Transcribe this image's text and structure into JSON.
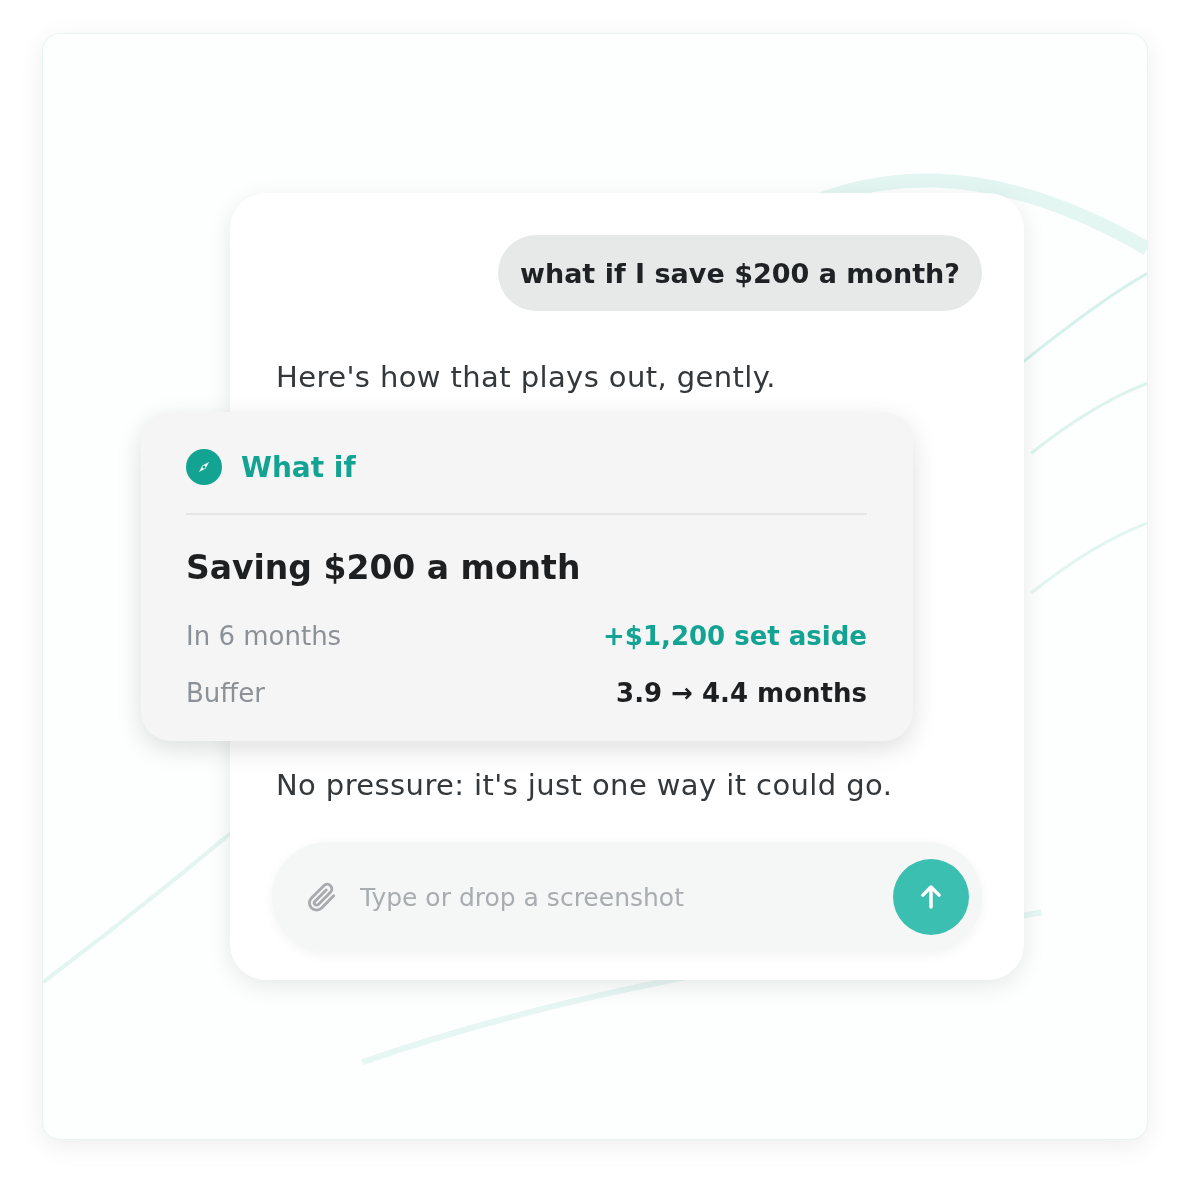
{
  "user_message": {
    "text": "what if I save $200 a month?"
  },
  "assistant": {
    "intro": "Here's how that plays out, gently.",
    "outro": "No pressure: it's just one way it could go."
  },
  "what_if_card": {
    "label": "What if",
    "title": "Saving $200 a month",
    "rows": [
      {
        "label": "In 6 months",
        "value": "+$1,200 set aside",
        "kind": "accent"
      },
      {
        "label": "Buffer",
        "value": "3.9 → 4.4 months",
        "kind": "strong"
      }
    ]
  },
  "composer": {
    "placeholder": "Type or drop a screenshot"
  }
}
